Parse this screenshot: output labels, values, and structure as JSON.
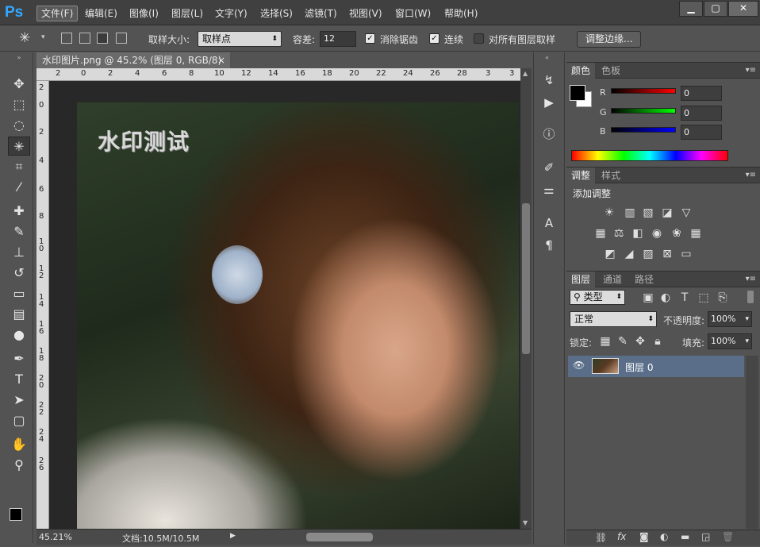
{
  "app": {
    "logo": "Ps"
  },
  "menu": [
    {
      "label": "文件(F)",
      "active": true
    },
    {
      "label": "编辑(E)"
    },
    {
      "label": "图像(I)"
    },
    {
      "label": "图层(L)"
    },
    {
      "label": "文字(Y)"
    },
    {
      "label": "选择(S)"
    },
    {
      "label": "滤镜(T)"
    },
    {
      "label": "视图(V)"
    },
    {
      "label": "窗口(W)"
    },
    {
      "label": "帮助(H)"
    }
  ],
  "window_controls": {
    "minimize": "▁",
    "maximize": "▢",
    "close": "✕"
  },
  "options": {
    "sample_size_label": "取样大小:",
    "sample_size_value": "取样点",
    "tolerance_label": "容差:",
    "tolerance_value": "12",
    "antialias_label": "消除锯齿",
    "antialias_checked": true,
    "contiguous_label": "连续",
    "contiguous_checked": true,
    "sample_all_label": "对所有图层取样",
    "sample_all_checked": false,
    "refine_edge_button": "调整边缘..."
  },
  "document": {
    "tab_title": "水印图片.png @ 45.2% (图层 0, RGB/8)",
    "tab_close": "×",
    "watermark_text": "水印测试",
    "ruler_top_labels": [
      "2",
      "0",
      "2",
      "4",
      "6",
      "8",
      "10",
      "12",
      "14",
      "16",
      "18",
      "20",
      "22",
      "24",
      "26",
      "28",
      "3"
    ],
    "ruler_left_labels": [
      "2",
      "0",
      "2",
      "4",
      "6",
      "8",
      "10",
      "12",
      "14",
      "16",
      "18",
      "20",
      "22",
      "24",
      "26"
    ],
    "zoom": "45.21%",
    "doc_size": "文档:10.5M/10.5M"
  },
  "color_panel": {
    "tabs": [
      "颜色",
      "色板"
    ],
    "active_tab": "颜色",
    "channels": [
      {
        "label": "R",
        "value": "0",
        "color": "#ff0000"
      },
      {
        "label": "G",
        "value": "0",
        "color": "#00ff00"
      },
      {
        "label": "B",
        "value": "0",
        "color": "#0000ff"
      }
    ]
  },
  "adjust_panel": {
    "tabs": [
      "调整",
      "样式"
    ],
    "active_tab": "调整",
    "title": "添加调整"
  },
  "layers_panel": {
    "tabs": [
      "图层",
      "通道",
      "路径"
    ],
    "active_tab": "图层",
    "filter_label": "类型",
    "blend_mode": "正常",
    "opacity_label": "不透明度:",
    "opacity_value": "100%",
    "lock_label": "锁定:",
    "fill_label": "填充:",
    "fill_value": "100%",
    "layers": [
      {
        "name": "图层 0",
        "visible": true,
        "selected": true
      }
    ]
  }
}
